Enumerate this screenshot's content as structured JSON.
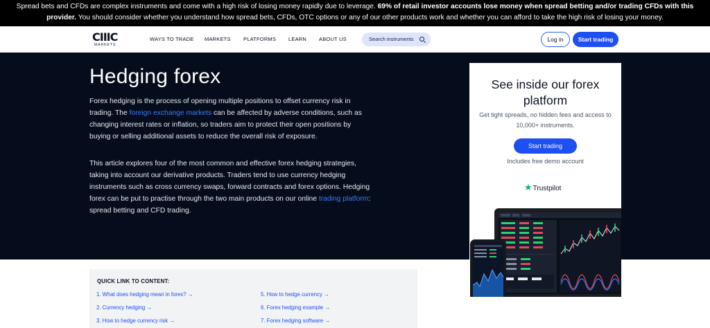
{
  "risk_banner": {
    "part1": "Spread bets and CFDs are complex instruments and come with a high risk of losing money rapidly due to leverage. ",
    "bold": "69% of retail investor accounts lose money when spread betting and/or trading CFDs with this provider.",
    "part2": " You should consider whether you understand how spread bets, CFDs, OTC options or any of our other products work and whether you can afford to take the high risk of losing your money."
  },
  "nav": {
    "logo_mark": "CIIIC",
    "logo_sub": "MARKETS",
    "items": [
      "WAYS TO TRADE",
      "MARKETS",
      "PLATFORMS",
      "LEARN",
      "ABOUT US"
    ],
    "search_label": "Search instruments",
    "login_label": "Log in",
    "start_label": "Start trading"
  },
  "hero": {
    "title": "Hedging forex",
    "p1_a": "Forex hedging is the process of opening multiple positions to offset currency risk in trading. The ",
    "p1_link": "foreign exchange markets",
    "p1_b": " can be affected by adverse conditions, such as changing interest rates or inflation, so traders aim to protect their open positions by buying or selling additional assets to reduce the overall risk of exposure.",
    "p2_a": "This article explores four of the most common and effective forex hedging strategies, taking into account our derivative products. Traders tend to use currency hedging instruments such as cross currency swaps, forward contracts and forex options. Hedging forex can be put to practise through the two main products on our online ",
    "p2_link": "trading platform",
    "p2_b": ": spread betting and CFD trading."
  },
  "card": {
    "title": "See inside our forex platform",
    "subtitle": "Get tight spreads, no hidden fees and access to 10,000+ instruments.",
    "cta": "Start trading",
    "demo": "Includes free demo account",
    "trustpilot": "Trustpilot"
  },
  "quick_links": {
    "title": "QUICK LINK TO CONTENT:",
    "left": [
      "1. What does hedging mean in forex? →",
      "2. Currency hedging →",
      "3. How to hedge currency risk →"
    ],
    "right": [
      "5. How to hedge currency →",
      "6. Forex hedging example →",
      "7. Forex hedging software →"
    ]
  },
  "colors": {
    "brand_blue": "#1d4ff2",
    "hero_bg": "#050d1c",
    "link": "#3b7bf6",
    "trustpilot_green": "#00b67a"
  }
}
